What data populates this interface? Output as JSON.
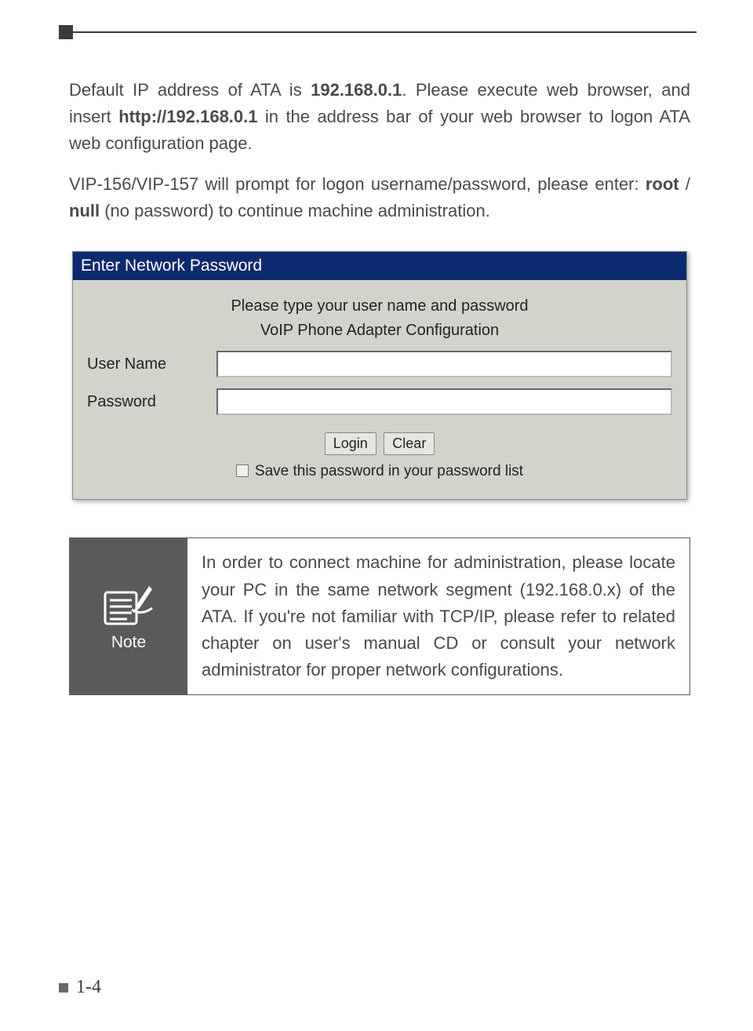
{
  "body": {
    "para1_pre": "Default IP address of ATA is ",
    "para1_ip": "192.168.0.1",
    "para1_mid": ". Please execute web browser, and insert ",
    "para1_url": "http://192.168.0.1",
    "para1_post": " in the address bar of your web browser to logon ATA web configuration page.",
    "para2_pre": "VIP-156/VIP-157 will prompt for logon username/password, please enter: ",
    "para2_root": "root",
    "para2_slash": " / ",
    "para2_null": "null",
    "para2_post": " (no password) to continue machine administration."
  },
  "dialog": {
    "title": "Enter Network Password",
    "line1": "Please type your user name and password",
    "line2": "VoIP Phone Adapter Configuration",
    "user_label": "User Name",
    "pass_label": "Password",
    "login": "Login",
    "clear": "Clear",
    "save": "Save this password in your password list"
  },
  "note": {
    "label": "Note",
    "text": "In order to connect machine for administration, please locate your PC in the same network segment (192.168.0.x) of the ATA. If you're not familiar with TCP/IP, please refer to related chapter on user's manual CD or consult your network administrator for proper network configurations."
  },
  "footer": {
    "page": "1-4"
  }
}
